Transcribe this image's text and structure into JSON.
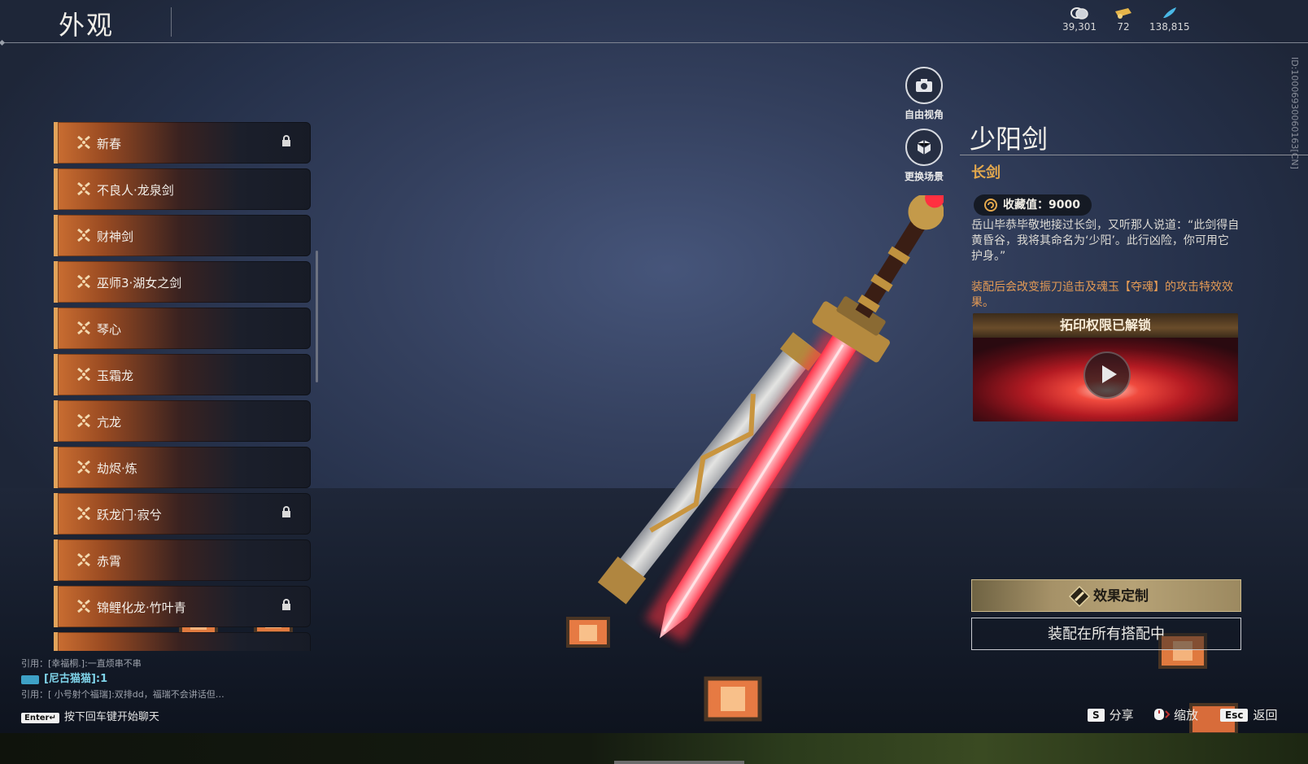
{
  "header": {
    "title": "外观",
    "currencies": [
      {
        "icon": "coin-icon",
        "value": "39,301"
      },
      {
        "icon": "ticket-icon",
        "value": "72"
      },
      {
        "icon": "feather-icon",
        "value": "138,815"
      }
    ],
    "id_text": "ID:10006930060163[CN]"
  },
  "list": {
    "items": [
      {
        "label": "新春",
        "locked": true
      },
      {
        "label": "不良人·龙泉剑",
        "locked": false
      },
      {
        "label": "财神剑",
        "locked": false
      },
      {
        "label": "巫师3·湖女之剑",
        "locked": false
      },
      {
        "label": "琴心",
        "locked": false
      },
      {
        "label": "玉霜龙",
        "locked": false
      },
      {
        "label": "亢龙",
        "locked": false
      },
      {
        "label": "劫烬·炼",
        "locked": false
      },
      {
        "label": "跃龙门·寂兮",
        "locked": true
      },
      {
        "label": "赤霄",
        "locked": false
      },
      {
        "label": "锦鲤化龙·竹叶青",
        "locked": true
      }
    ]
  },
  "camera": {
    "free_view": "自由视角",
    "change_scene": "更换场景"
  },
  "detail": {
    "name": "少阳剑",
    "type": "长剑",
    "collect_value": "收藏值：9000",
    "description": "岳山毕恭毕敬地接过长剑，又听那人说道：“此剑得自黄昏谷，我将其命名为‘少阳’。此行凶险，你可用它护身。”",
    "effect_note": "装配后会改变振刀追击及魂玉【夺魂】的攻击特效效果。",
    "video_caption": "拓印权限已解锁",
    "customize_button": "效果定制",
    "equip_all_button": "装配在所有搭配中"
  },
  "chat": {
    "line1": "引用：[幸福桐.]:一直烦串不串",
    "line2": "[尼古猫猫]:1",
    "line3": "引用：[ 小号射个福瑞]:双排dd，福瑞不会讲话但…",
    "enter_key": "Enter↵",
    "enter_hint": "按下回车键开始聊天"
  },
  "hints": {
    "share_key": "S",
    "share": "分享",
    "zoom": "缩放",
    "back_key": "Esc",
    "back": "返回"
  },
  "colors": {
    "accent_gold": "#e3a84d",
    "accent_orange": "#e39a55",
    "list_gradient": "#c96d31",
    "sword_blade": "#ff4a55"
  }
}
